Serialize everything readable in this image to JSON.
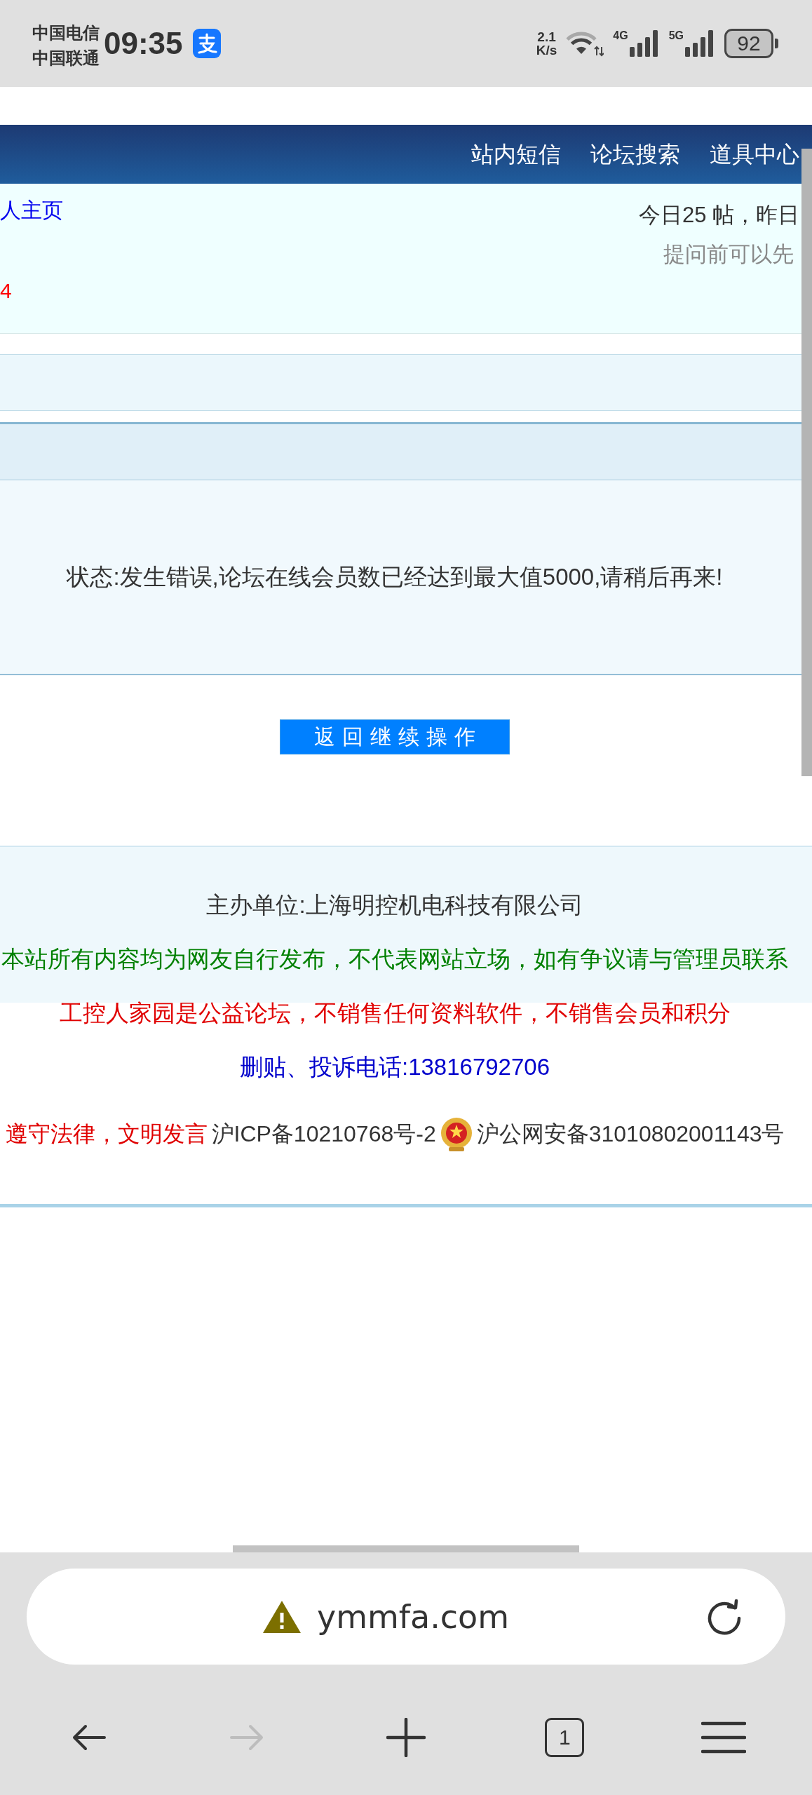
{
  "status_bar": {
    "carriers": [
      "中国电信",
      "中国联通"
    ],
    "time": "09:35",
    "net_speed": [
      "2.1",
      "K/s"
    ],
    "networks": [
      "4G",
      "5G"
    ],
    "battery": "92"
  },
  "nav": {
    "links": [
      "站内短信",
      "论坛搜索",
      "道具中心"
    ]
  },
  "info": {
    "profile_link": "人主页",
    "notice": "4",
    "stats": "今日25 帖，昨日",
    "hint": "提问前可以先"
  },
  "message": {
    "text": "状态:发生错误,论坛在线会员数已经达到最大值5000,请稍后再来!",
    "button": "返回继续操作"
  },
  "footer": {
    "lines": [
      {
        "text": "主办单位:上海明控机电科技有限公司",
        "color": "#333333"
      },
      {
        "text": "本站所有内容均为网友自行发布，不代表网站立场，如有争议请与管理员联系",
        "color": "#008000"
      },
      {
        "text": "工控人家园是公益论坛，不销售任何资料软件，不销售会员和积分",
        "color": "#e00000"
      },
      {
        "text": "删贴、投诉电话:13816792706",
        "color": "#0000cc"
      }
    ],
    "records": [
      {
        "kind": "text",
        "text": "遵守法律，文明发言",
        "color": "#e00000"
      },
      {
        "kind": "text",
        "text": "沪ICP备10210768号-2",
        "color": "#333333"
      },
      {
        "kind": "emblem"
      },
      {
        "kind": "text",
        "text": "沪公网安备31010802001143号",
        "color": "#333333"
      }
    ]
  },
  "browser": {
    "url": "ymmfa.com",
    "warning": true,
    "toolbar": [
      {
        "kind": "back",
        "disabled": false
      },
      {
        "kind": "forward",
        "disabled": true
      },
      {
        "kind": "new_tab",
        "disabled": false
      },
      {
        "kind": "tabs",
        "count": "1",
        "disabled": false
      },
      {
        "kind": "menu",
        "disabled": false
      }
    ]
  }
}
